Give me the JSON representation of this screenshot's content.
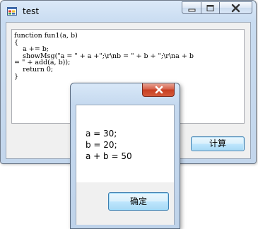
{
  "main_window": {
    "title": "test",
    "icon": "windows-form-app-icon",
    "caption_buttons": [
      "minimize-icon",
      "maximize-icon",
      "close-icon"
    ],
    "code_lines": [
      "function fun1(a, b)",
      "{",
      "    a += b;",
      "    showMsg(\"a = \" + a +\";\\r\\nb = \" + b + \";\\r\\na + b",
      "= \" + add(a, b));",
      "    return 0;",
      "}"
    ],
    "calculate_label": "计算"
  },
  "message_box": {
    "close_icon": "close-icon",
    "lines": [
      "a = 30;",
      "b = 20;",
      "a + b = 50"
    ],
    "ok_label": "确定"
  },
  "colors": {
    "accent_close": "#c73f22",
    "button_border": "#3c7fb1",
    "frame": "#c3d6ec"
  }
}
